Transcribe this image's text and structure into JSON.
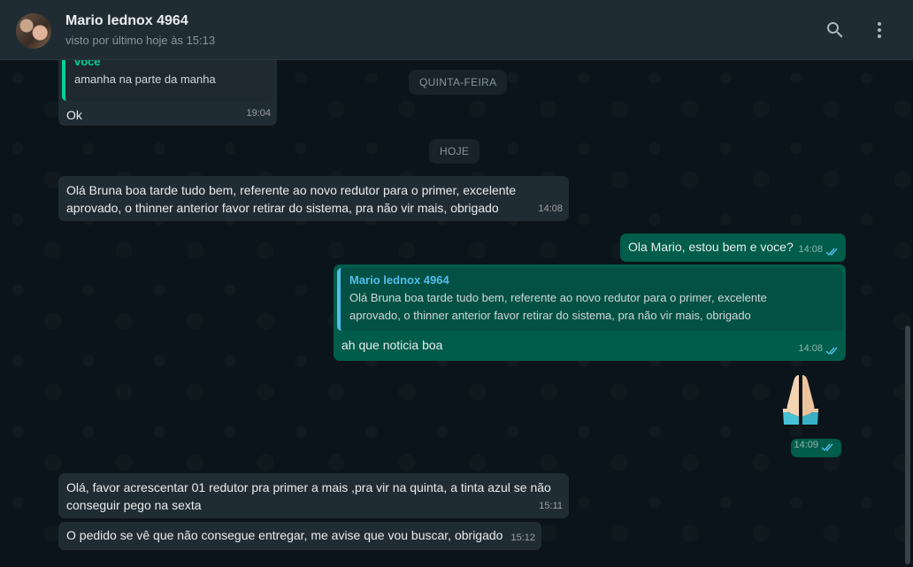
{
  "header": {
    "contact_name": "Mario lednox 4964",
    "status": "visto por último hoje às 15:13",
    "icons": [
      "search-icon",
      "menu-icon"
    ]
  },
  "dates": {
    "thursday": "QUINTA-FEIRA",
    "today": "HOJE"
  },
  "messages": [
    {
      "dir": "in",
      "quote_author": "voce",
      "quote_text": "amanha na parte da manha",
      "text": "Ok",
      "time": "19:04"
    },
    {
      "dir": "in",
      "line1": "Olá Bruna boa tarde tudo bem,  referente ao novo redutor para o primer, excelente",
      "line2": "aprovado, o thinner anterior favor retirar do sistema, pra não vir mais, obrigado",
      "time": "14:08"
    },
    {
      "dir": "out",
      "text": "Ola Mario, estou bem e voce?",
      "time": "14:08"
    },
    {
      "dir": "out",
      "quote_author": "Mario lednox 4964",
      "quote_line1": "Olá Bruna boa tarde tudo bem,  referente ao novo redutor para o primer, excelente",
      "quote_line2": "aprovado, o thinner anterior favor retirar do sistema, pra não vir mais, obrigado",
      "text": "ah que noticia boa",
      "time": "14:08"
    },
    {
      "dir": "out",
      "emoji": "folded-hands",
      "time": "14:09"
    },
    {
      "dir": "in",
      "line1": "Olá, favor acrescentar 01 redutor pra primer a mais ,pra vir na quinta, a tinta azul se não",
      "line2": "conseguir pego na sexta",
      "time": "15:11"
    },
    {
      "dir": "in",
      "text": "O pedido se vê que não consegue entregar, me avise que vou buscar, obrigado",
      "time": "15:12"
    }
  ],
  "colors": {
    "incoming": "#202c33",
    "outgoing": "#005c4b",
    "read_ticks": "#53bdeb"
  }
}
